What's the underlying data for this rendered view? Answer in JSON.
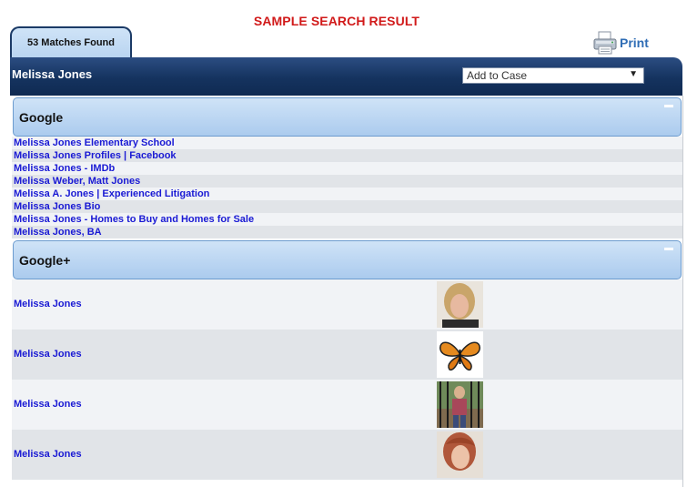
{
  "page": {
    "title": "SAMPLE SEARCH RESULT"
  },
  "tab": {
    "label": "53 Matches Found"
  },
  "print": {
    "label": "Print",
    "icon": "printer-icon"
  },
  "header": {
    "name": "Melissa Jones",
    "case_select": {
      "selected": "Add to Case"
    }
  },
  "google": {
    "title": "Google",
    "links": [
      "Melissa Jones Elementary School",
      "Melissa Jones Profiles | Facebook",
      "Melissa Jones - IMDb",
      "Melissa Weber, Matt Jones",
      "Melissa A. Jones | Experienced Litigation",
      "Melissa Jones Bio",
      "Melissa Jones - Homes to Buy and Homes for Sale",
      "Melissa Jones, BA"
    ]
  },
  "googleplus": {
    "title": "Google+",
    "profiles": [
      {
        "name": "Melissa Jones",
        "thumb": "blurred-blonde-portrait"
      },
      {
        "name": "Melissa Jones",
        "thumb": "monarch-butterfly"
      },
      {
        "name": "Melissa Jones",
        "thumb": "child-by-fence"
      },
      {
        "name": "Melissa Jones",
        "thumb": "blurred-redhead-portrait"
      }
    ]
  },
  "colors": {
    "title_red": "#d11a1a",
    "header_navy": "#15335f",
    "section_blue": "#b7d3f0",
    "link_blue": "#1a1ad4"
  }
}
